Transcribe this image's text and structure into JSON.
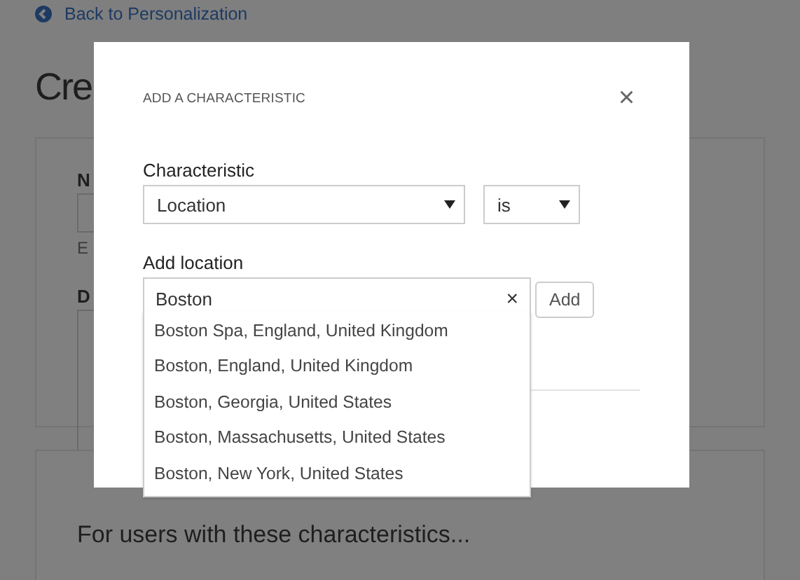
{
  "page": {
    "back_link": "Back to Personalization",
    "heading": "Cre",
    "name_label": "N",
    "name_hint": "E",
    "description_label": "D",
    "section_title": "For users with these characteristics..."
  },
  "dialog": {
    "title": "ADD A CHARACTERISTIC",
    "close": "×",
    "characteristic_label": "Characteristic",
    "characteristic_value": "Location",
    "operator_value": "is",
    "location_label": "Add location",
    "location_value": "Boston",
    "clear": "×",
    "add_button": "Add",
    "suggestions": [
      "Boston Spa, England, United Kingdom",
      "Boston, England, United Kingdom",
      "Boston, Georgia, United States",
      "Boston, Massachusetts, United States",
      "Boston, New York, United States"
    ]
  }
}
